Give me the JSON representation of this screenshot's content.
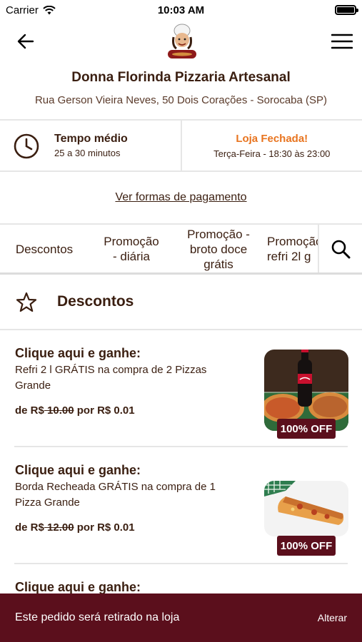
{
  "status_bar": {
    "carrier": "Carrier",
    "time": "10:03 AM"
  },
  "header": {
    "logo_alt": "Donna Florinda"
  },
  "store": {
    "name": "Donna Florinda Pizzaria Artesanal",
    "address": "Rua Gerson Vieira Neves, 50 Dois Corações - Sorocaba (SP)"
  },
  "info": {
    "time_title": "Tempo médio",
    "time_value": "25 a 30 minutos",
    "status_title": "Loja Fechada!",
    "status_hours": "Terça-Feira - 18:30 às 23:00",
    "status_color": "#e8741f"
  },
  "payment": {
    "link_label": "Ver formas de pagamento"
  },
  "tabs": [
    {
      "label": "Descontos"
    },
    {
      "label": "Promoção\n- diária"
    },
    {
      "label": "Promoção -\nbroto doce\ngrátis"
    },
    {
      "label": "Promoção\nrefri 2l g"
    }
  ],
  "section": {
    "title": "Descontos",
    "icon": "star-icon"
  },
  "items": [
    {
      "title": "Clique aqui e ganhe:",
      "desc": "Refri 2 l GRÁTIS na compra de 2 Pizzas Grande",
      "price_prefix": "de R$",
      "old_price": " 10.00",
      "price_mid": " por ",
      "new_price": "R$ 0.01",
      "badge": "100% OFF"
    },
    {
      "title": "Clique aqui e ganhe:",
      "desc": "Borda Recheada GRÁTIS na compra de 1 Pizza Grande",
      "price_prefix": "de R$",
      "old_price": " 12.00",
      "price_mid": " por ",
      "new_price": "R$ 0.01",
      "badge": "100% OFF"
    },
    {
      "title": "Clique aqui e ganhe:"
    }
  ],
  "bottom_bar": {
    "text": "Este pedido será retirado na loja",
    "action": "Alterar",
    "color": "#5b0f1c"
  }
}
